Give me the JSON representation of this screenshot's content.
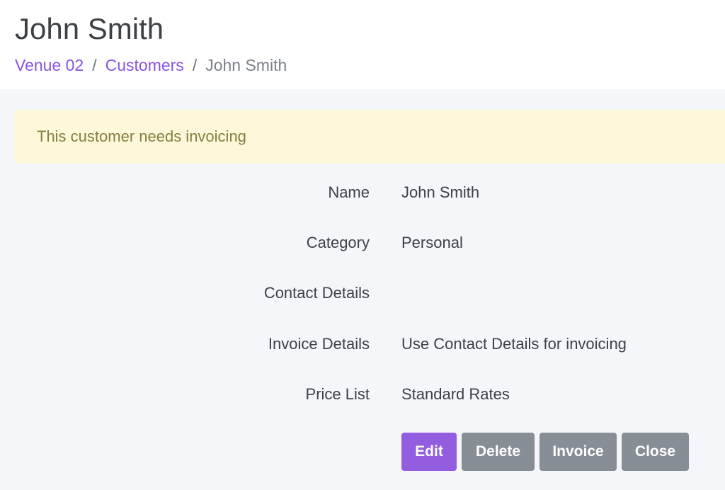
{
  "header": {
    "title": "John Smith",
    "breadcrumb": {
      "items": [
        "Venue 02",
        "Customers"
      ],
      "separator": "/",
      "current": "John Smith"
    }
  },
  "alert": {
    "text": "This customer needs invoicing"
  },
  "details": [
    {
      "label": "Name",
      "value": "John Smith"
    },
    {
      "label": "Category",
      "value": "Personal"
    },
    {
      "label": "Contact Details",
      "value": ""
    },
    {
      "label": "Invoice Details",
      "value": "Use Contact Details for invoicing"
    },
    {
      "label": "Price List",
      "value": "Standard Rates"
    }
  ],
  "actions": {
    "edit": "Edit",
    "delete": "Delete",
    "invoice": "Invoice",
    "close": "Close"
  },
  "colors": {
    "accent": "#925ddf",
    "link": "#8a54dc",
    "secondary_button": "#878e96",
    "alert_background": "#fef8da",
    "alert_text": "#857e3f",
    "page_background": "#f4f6f9"
  }
}
